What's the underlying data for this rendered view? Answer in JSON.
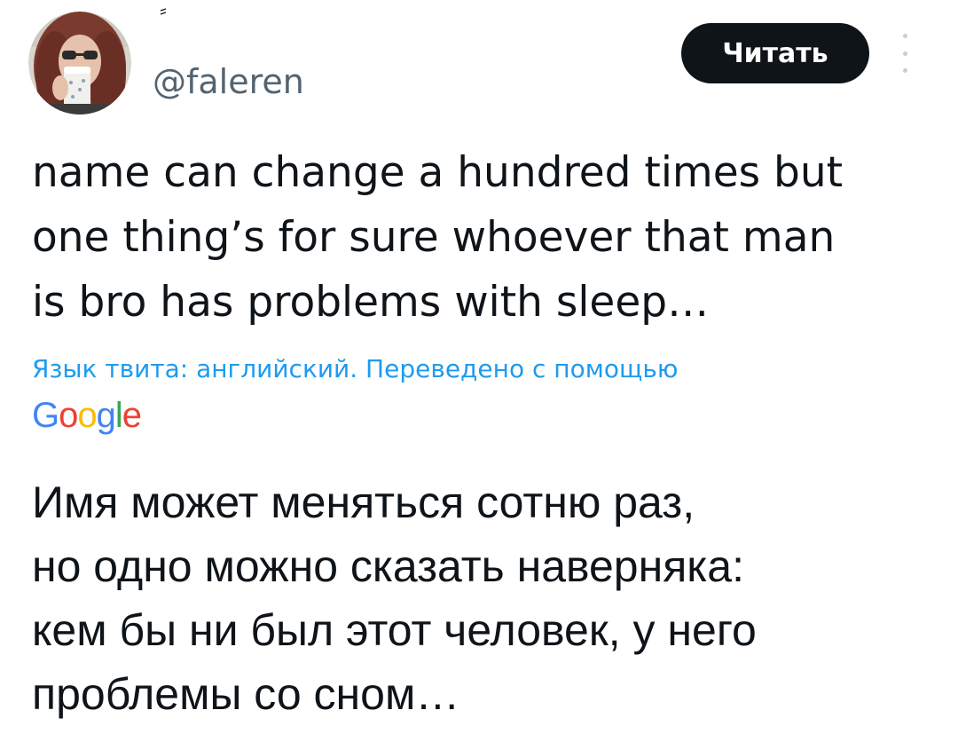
{
  "header": {
    "handle": "@faleren",
    "follow_button_label": "Читать",
    "more_icon": "more-vertical-icon"
  },
  "tweet": {
    "original_text": "name can change a hundred times but\none thing’s for sure whoever that man\nis bro has problems with sleep…",
    "translation_note": "Язык твита: английский. Переведено с помощью",
    "translation_provider": "Google",
    "translated_text": "Имя может меняться сотню раз,\nно одно можно сказать наверняка:\nкем бы ни был этот человек, у него\nпроблемы со сном…"
  },
  "colors": {
    "text": "#0f1419",
    "handle": "#536471",
    "link": "#1d9bf0",
    "button_bg": "#0f1419",
    "button_text": "#ffffff"
  }
}
